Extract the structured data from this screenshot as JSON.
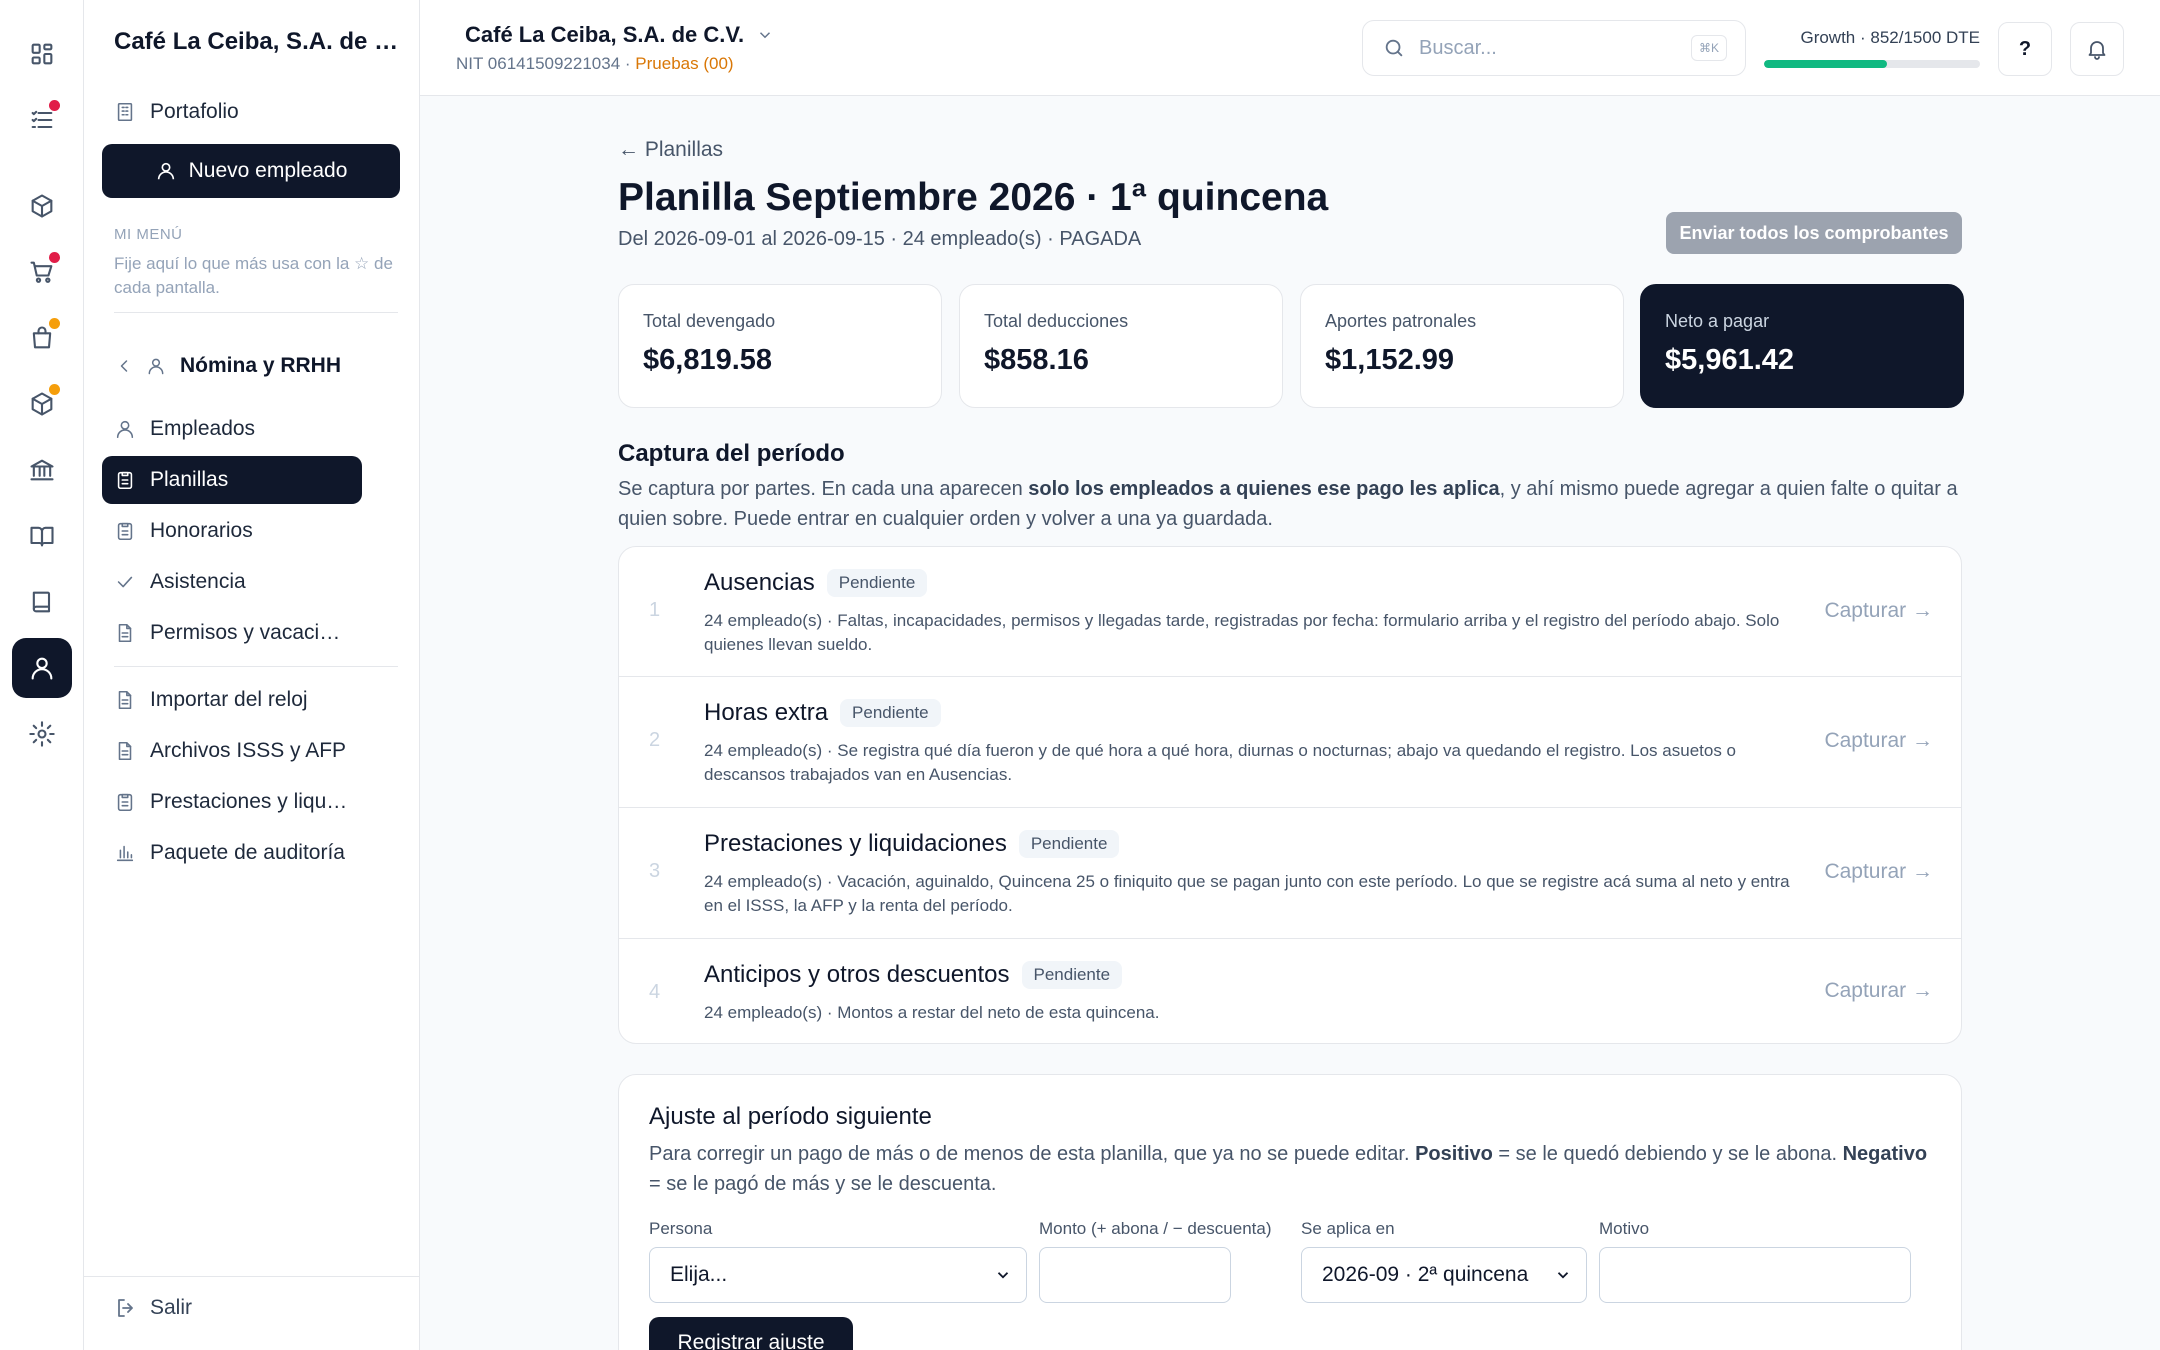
{
  "colors": {
    "primary_dark": "#0f172a",
    "accent_green": "#10b981",
    "warning_orange": "#d97706",
    "notification_red": "#e11d48",
    "notification_amber": "#f59e0b",
    "muted_button": "#9ca3af"
  },
  "rail": {
    "items": [
      {
        "icon": "grid-icon"
      },
      {
        "icon": "tasks-list-icon",
        "dot": "red"
      },
      {
        "icon": "package-icon"
      },
      {
        "icon": "cart-icon",
        "dot": "red"
      },
      {
        "icon": "shopping-bag-icon",
        "dot": "amber"
      },
      {
        "icon": "package-icon"
      },
      {
        "icon": "bank-icon"
      },
      {
        "icon": "open-book-icon"
      },
      {
        "icon": "book-icon"
      },
      {
        "icon": "user-icon",
        "active": true
      },
      {
        "icon": "gear-icon"
      }
    ]
  },
  "sidebar": {
    "company": "Café La Ceiba, S.A. de C.V.",
    "portfolio": "Portafolio",
    "new_employee": "Nuevo empleado",
    "my_menu_label": "MI MENÚ",
    "my_menu_hint": "Fije aquí lo que más usa con la ☆ de cada pantalla.",
    "section": "Nómina y RRHH",
    "items": [
      {
        "label": "Empleados",
        "icon": "user-icon"
      },
      {
        "label": "Planillas",
        "icon": "clipboard-icon",
        "active": true
      },
      {
        "label": "Honorarios",
        "icon": "clipboard-icon"
      },
      {
        "label": "Asistencia",
        "icon": "check-icon"
      },
      {
        "label": "Permisos y vacaciones",
        "icon": "document-icon"
      },
      {
        "label": "Importar del reloj",
        "icon": "document-icon"
      },
      {
        "label": "Archivos ISSS y AFP",
        "icon": "document-icon"
      },
      {
        "label": "Prestaciones y liquidaciones",
        "icon": "clipboard-icon"
      },
      {
        "label": "Paquete de auditoría",
        "icon": "bar-chart-icon"
      }
    ],
    "logout": "Salir"
  },
  "topbar": {
    "company": "Café La Ceiba, S.A. de C.V.",
    "nit": "NIT 06141509221034 · ",
    "mode": "Pruebas (00)",
    "search_placeholder": "Buscar...",
    "search_shortcut": "⌘K",
    "plan_label": "Growth · 852/1500 DTE",
    "plan_usage_fraction": 0.568,
    "help": "?"
  },
  "main": {
    "back": "← Planillas",
    "title": "Planilla Septiembre 2026 · 1ª quincena",
    "subtitle": "Del 2026-09-01 al 2026-09-15 · 24 empleado(s) · PAGADA",
    "send_all": "Enviar todos los comprobantes",
    "stats": [
      {
        "label": "Total devengado",
        "value": "$6,819.58"
      },
      {
        "label": "Total deducciones",
        "value": "$858.16"
      },
      {
        "label": "Aportes patronales",
        "value": "$1,152.99"
      },
      {
        "label": "Neto a pagar",
        "value": "$5,961.42",
        "highlight": true
      }
    ],
    "capture": {
      "title": "Captura del período",
      "desc_1": "Se captura por partes. En cada una aparecen ",
      "desc_bold": "solo los empleados a quienes ese pago les aplica",
      "desc_2": ", y ahí mismo puede agregar a quien falte o quitar a quien sobre. Puede entrar en cualquier orden y volver a una ya guardada.",
      "steps": [
        {
          "num": "1",
          "name": "Ausencias",
          "status": "Pendiente",
          "desc": "24 empleado(s) · Faltas, incapacidades, permisos y llegadas tarde, registradas por fecha: formulario arriba y el registro del período abajo. Solo quienes llevan sueldo.",
          "action": "Capturar →"
        },
        {
          "num": "2",
          "name": "Horas extra",
          "status": "Pendiente",
          "desc": "24 empleado(s) · Se registra qué día fueron y de qué hora a qué hora, diurnas o nocturnas; abajo va quedando el registro. Los asuetos o descansos trabajados van en Ausencias.",
          "action": "Capturar →"
        },
        {
          "num": "3",
          "name": "Prestaciones y liquidaciones",
          "status": "Pendiente",
          "desc": "24 empleado(s) · Vacación, aguinaldo, Quincena 25 o finiquito que se pagan junto con este período. Lo que se registre acá suma al neto y entra en el ISSS, la AFP y la renta del período.",
          "action": "Capturar →"
        },
        {
          "num": "4",
          "name": "Anticipos y otros descuentos",
          "status": "Pendiente",
          "desc": "24 empleado(s) · Montos a restar del neto de esta quincena.",
          "action": "Capturar →"
        }
      ]
    },
    "adjustment": {
      "title": "Ajuste al período siguiente",
      "desc_1": "Para corregir un pago de más o de menos de esta planilla, que ya no se puede editar. ",
      "positive": "Positivo",
      "desc_2": " = se le quedó debiendo y se le abona. ",
      "negative": "Negativo",
      "desc_3": " = se le pagó de más y se le descuenta.",
      "person_label": "Persona",
      "person_value": "Elija...",
      "amount_label": "Monto (+ abona / − descuenta)",
      "amount_value": "",
      "applies_label": "Se aplica en",
      "applies_value": "2026-09 · 2ª quincena",
      "reason_label": "Motivo",
      "reason_value": "",
      "submit": "Registrar ajuste"
    }
  }
}
